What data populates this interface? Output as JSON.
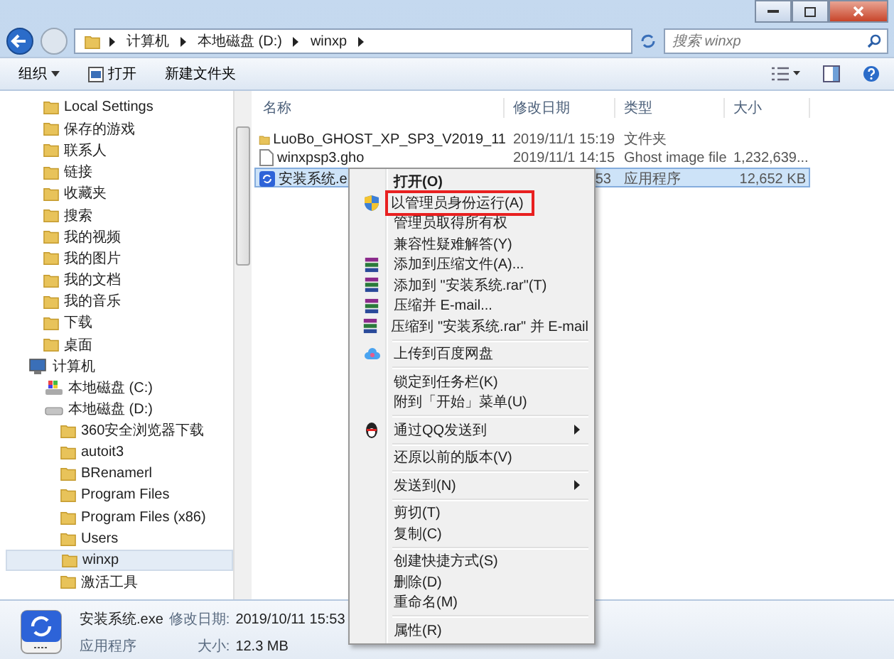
{
  "address_bar": {
    "crumbs": [
      "计算机",
      "本地磁盘 (D:)",
      "winxp"
    ]
  },
  "search": {
    "placeholder": "搜索 winxp"
  },
  "toolbar": {
    "buttons": [
      {
        "label": "组织",
        "dropdown": true
      },
      {
        "label": "打开",
        "dropdown": false
      },
      {
        "label": "新建文件夹",
        "dropdown": false
      }
    ]
  },
  "navigation": {
    "folders": [
      {
        "label": "Local Settings",
        "selected": false
      },
      {
        "label": "保存的游戏",
        "selected": false
      },
      {
        "label": "联系人",
        "selected": false
      },
      {
        "label": "链接",
        "selected": false
      },
      {
        "label": "收藏夹",
        "selected": false
      },
      {
        "label": "搜索",
        "selected": false
      },
      {
        "label": "我的视频",
        "selected": false
      },
      {
        "label": "我的图片",
        "selected": false
      },
      {
        "label": "我的文档",
        "selected": false
      },
      {
        "label": "我的音乐",
        "selected": false
      },
      {
        "label": "下载",
        "selected": false
      },
      {
        "label": "桌面",
        "selected": false
      }
    ],
    "tree": [
      {
        "label": "计算机",
        "kind": "computer",
        "selected": false,
        "children": [
          {
            "label": "本地磁盘 (C:)",
            "kind": "system",
            "selected": false
          },
          {
            "label": "本地磁盘 (D:)",
            "kind": "drive",
            "selected": false,
            "children": [
              {
                "label": "360安全浏览器下载",
                "kind": "folder",
                "selected": false
              },
              {
                "label": "autoit3",
                "kind": "folder",
                "selected": false
              },
              {
                "label": "BRenamerl",
                "kind": "folder",
                "selected": false
              },
              {
                "label": "Program Files",
                "kind": "folder",
                "selected": false
              },
              {
                "label": "Program Files (x86)",
                "kind": "folder",
                "selected": false
              },
              {
                "label": "Users",
                "kind": "folder",
                "selected": false
              },
              {
                "label": "winxp",
                "kind": "folder",
                "selected": true
              },
              {
                "label": "激活工具",
                "kind": "folder",
                "selected": false
              }
            ]
          }
        ]
      }
    ]
  },
  "file_list": {
    "columns": [
      "名称",
      "修改日期",
      "类型",
      "大小"
    ],
    "rows": [
      {
        "kind": "folder",
        "name": "LuoBo_GHOST_XP_SP3_V2019_11",
        "date": "2019/11/1 15:19",
        "type": "文件夹",
        "selected": false
      },
      {
        "kind": "file",
        "name": "winxpsp3.gho",
        "date": "2019/11/1 14:15",
        "type": "Ghost image file",
        "size": "1,232,639...",
        "selected": false
      },
      {
        "kind": "exe",
        "name": "安装系统.e",
        "date": "53",
        "type": "应用程序",
        "size": "12,652 KB",
        "selected": true
      }
    ]
  },
  "context_menu": {
    "items": [
      {
        "kind": "item",
        "label": "打开(O)",
        "default": true,
        "submenu": false,
        "highlighted": false
      },
      {
        "kind": "admin",
        "label": "以管理员身份运行(A)",
        "default": false,
        "submenu": false,
        "highlighted": true
      },
      {
        "kind": "item",
        "label": "管理员取得所有权",
        "default": false,
        "submenu": false,
        "highlighted": false
      },
      {
        "kind": "item",
        "label": "兼容性疑难解答(Y)",
        "default": false,
        "submenu": false,
        "highlighted": false
      },
      {
        "kind": "archive",
        "label": "添加到压缩文件(A)...",
        "default": false,
        "submenu": false,
        "highlighted": false
      },
      {
        "kind": "archive",
        "label": "添加到 \"安装系统.rar\"(T)",
        "default": false,
        "submenu": false,
        "highlighted": false
      },
      {
        "kind": "archive",
        "label": "压缩并 E-mail...",
        "default": false,
        "submenu": false,
        "highlighted": false
      },
      {
        "kind": "archive",
        "label": "压缩到 \"安装系统.rar\" 并 E-mail",
        "default": false,
        "submenu": false,
        "highlighted": false
      },
      {
        "kind": "separator"
      },
      {
        "kind": "upload",
        "label": "上传到百度网盘",
        "default": false,
        "submenu": false,
        "highlighted": false
      },
      {
        "kind": "separator"
      },
      {
        "kind": "item",
        "label": "锁定到任务栏(K)",
        "default": false,
        "submenu": false,
        "highlighted": false
      },
      {
        "kind": "item",
        "label": "附到「开始」菜单(U)",
        "default": false,
        "submenu": false,
        "highlighted": false
      },
      {
        "kind": "separator"
      },
      {
        "kind": "qq",
        "label": "通过QQ发送到",
        "default": false,
        "submenu": true,
        "highlighted": false
      },
      {
        "kind": "separator"
      },
      {
        "kind": "item",
        "label": "还原以前的版本(V)",
        "default": false,
        "submenu": false,
        "highlighted": false
      },
      {
        "kind": "separator"
      },
      {
        "kind": "item",
        "label": "发送到(N)",
        "default": false,
        "submenu": true,
        "highlighted": false
      },
      {
        "kind": "separator"
      },
      {
        "kind": "item",
        "label": "剪切(T)",
        "default": false,
        "submenu": false,
        "highlighted": false
      },
      {
        "kind": "item",
        "label": "复制(C)",
        "default": false,
        "submenu": false,
        "highlighted": false
      },
      {
        "kind": "separator"
      },
      {
        "kind": "item",
        "label": "创建快捷方式(S)",
        "default": false,
        "submenu": false,
        "highlighted": false
      },
      {
        "kind": "item",
        "label": "删除(D)",
        "default": false,
        "submenu": false,
        "highlighted": false
      },
      {
        "kind": "item",
        "label": "重命名(M)",
        "default": false,
        "submenu": false,
        "highlighted": false
      },
      {
        "kind": "separator"
      },
      {
        "kind": "item",
        "label": "属性(R)",
        "default": false,
        "submenu": false,
        "highlighted": false
      }
    ]
  },
  "details_pane": {
    "name": "安装系统.exe",
    "type": "应用程序",
    "date_label": "修改日期:",
    "date": "2019/10/11 15:53",
    "size_label": "大小:",
    "size": "12.3 MB"
  }
}
